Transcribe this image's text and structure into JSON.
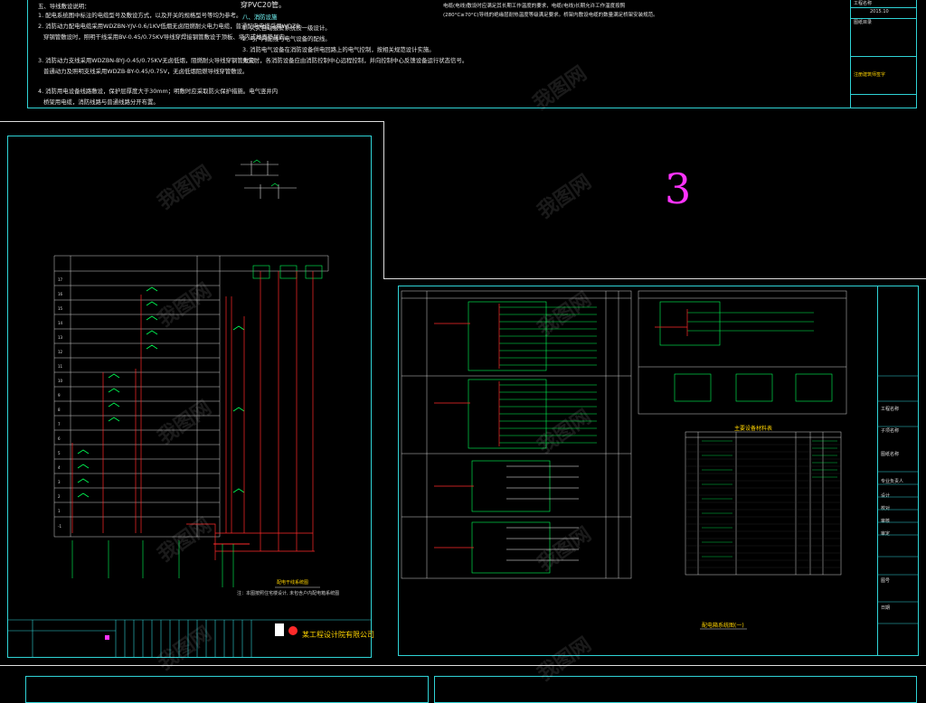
{
  "canvas": {
    "background": "#000000",
    "frame_color": "#2fd3d6"
  },
  "top_left_notes": {
    "heading": "五、导线敷设说明：",
    "lines": [
      "1. 配电系统图中标注的电缆型号及敷设方式，以及开关的规格型号等均为参考。",
      "2. 消防动力配电电缆采用WDZBN-YJV-0.6/1KV低烟无卤阻燃耐火电力电缆，普通配电电缆采用WDZB",
      "穿钢管敷设时，照明干线采用BV-0.45/0.75KV导线穿焊接钢管敷设于顶板、墙内或地面垫层内。",
      "3. 消防动力支线采用WDZBN-BYJ-0.45/0.75KV无卤低烟，阻燃耐火导线穿钢管敷设；",
      "普通动力及照明支线采用WDZB-BY-0.45/0.75V，无卤低烟阻燃导线穿管敷设。",
      "4. 消防用电设备线路敷设，保护层厚度大于30mm；明敷时应采取防火保护措施。电气竖井内",
      "桥架用电缆，消防线路与普通线路分开布置。"
    ]
  },
  "top_mid_notes": {
    "lines": [
      "穿PVC20管。",
      "八、消防设施",
      "1. 火灾自动报警系统按一级设计。",
      "2. 与户内配线与电气设备的配线。",
      "3. 消防电气设备在消防设备供电回路上的电气控制，按相关规范设计实施。",
      "火灾时，各消防设备应由消防控制中心远程控制，并向控制中心反馈设备运行状态信号。"
    ]
  },
  "top_right_text": {
    "line1": "电缆(电线)敷设时应满足其长期工作温度的要求，电缆(电线)长期允许工作温度按照",
    "line2": "(280°C≥70°C)导线的绝缘层耐热温度等级满足要求。桥架内敷设电缆的数量满足桥架安装规范。"
  },
  "title_block_top": {
    "rows": [
      "工程名称",
      "2015.10",
      "图纸目录"
    ],
    "stamp": "注册建筑师签字"
  },
  "page_number": "3",
  "left_sheet": {
    "title": "配电干线系统图",
    "caption": "注：本图按照住宅楼设计, 未包含户内配电箱系统图",
    "company": "某工程设计院有限公司",
    "floors": [
      "17",
      "16",
      "15",
      "14",
      "13",
      "12",
      "11",
      "10",
      "9",
      "8",
      "7",
      "6",
      "5",
      "4",
      "3",
      "2",
      "1",
      "-1"
    ]
  },
  "right_sheet": {
    "title": "配电箱系统图(一)",
    "table_title": "主要设备材料表",
    "sidebar_labels": [
      "工程名称",
      "子项名称",
      "图纸名称",
      "专业负责人",
      "设计",
      "校对",
      "审核",
      "审定",
      "图号",
      "日期"
    ]
  },
  "watermark": "我图网"
}
